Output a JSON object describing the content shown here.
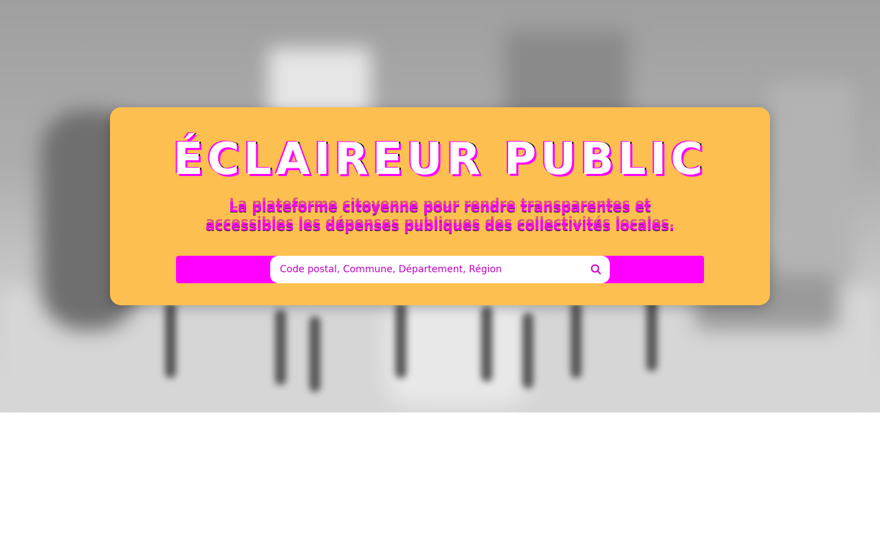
{
  "hero": {
    "title": "ÉCLAIREUR PUBLIC",
    "subtitle": "La plateforme citoyenne pour rendre transparentes et accessibles les dépenses publiques des collectivités locales."
  },
  "search": {
    "placeholder": "Code postal, Commune, Département, Région",
    "value": "",
    "icon": "search-icon"
  },
  "colors": {
    "card_background": "#fdbf4f",
    "accent": "#ff00ff",
    "title_text": "#ffffff"
  }
}
